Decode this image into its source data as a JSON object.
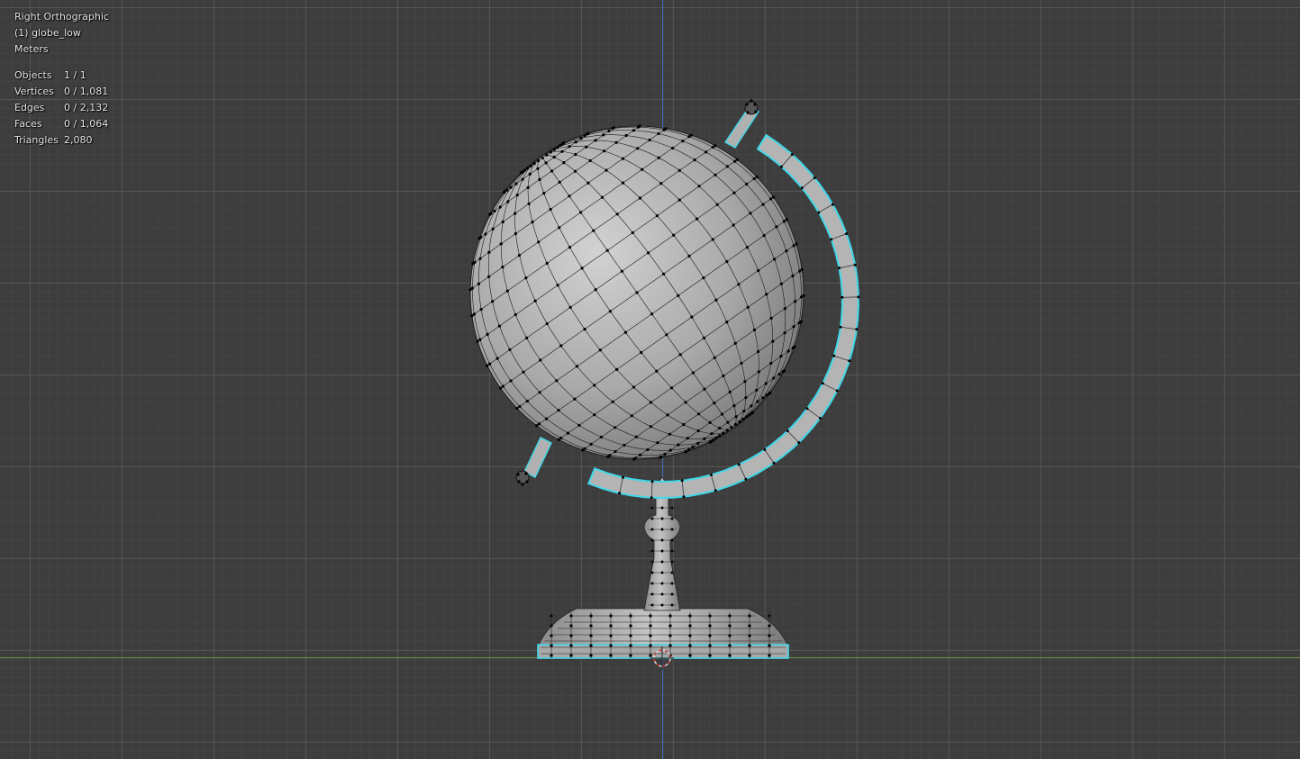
{
  "viewport": {
    "view_name": "Right Orthographic",
    "object_name": "(1) globe_low",
    "units": "Meters"
  },
  "stats": [
    {
      "label": "Objects",
      "value": "1 / 1"
    },
    {
      "label": "Vertices",
      "value": "0 / 1,081"
    },
    {
      "label": "Edges",
      "value": "0 / 2,132"
    },
    {
      "label": "Faces",
      "value": "0 / 1,064"
    },
    {
      "label": "Triangles",
      "value": "2,080"
    }
  ],
  "colors": {
    "background": "#3d3d3d",
    "axis_y": "#3f6fbf",
    "axis_x": "#6a8f3a",
    "seam_highlight": "#3fd8e8",
    "mesh_fill": "#a8a8a8",
    "vertex": "#000000"
  }
}
